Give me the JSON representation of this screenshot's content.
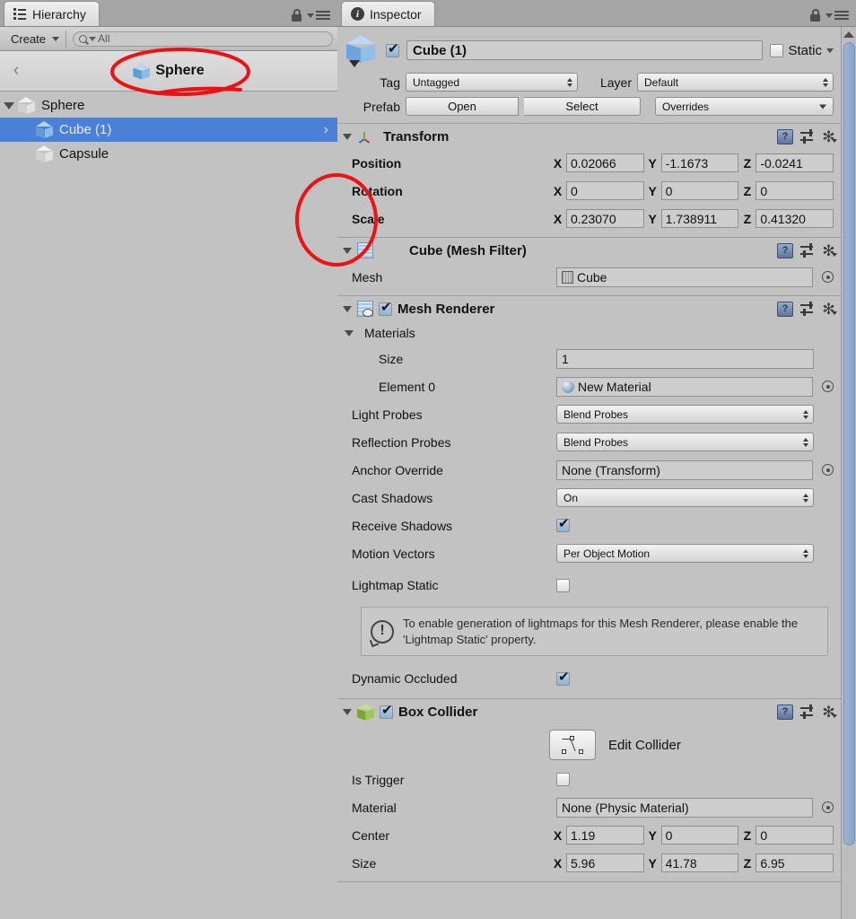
{
  "hierarchy": {
    "tab_label": "Hierarchy",
    "tab_icon": "hierarchy-list-icon",
    "create_label": "Create",
    "search_placeholder": "All",
    "breadcrumb_label": "Sphere",
    "breadcrumb_back": "‹",
    "tree": [
      {
        "label": "Sphere",
        "indent": 0,
        "icon": "white-cube-icon",
        "selected": false,
        "expanded": true
      },
      {
        "label": "Cube (1)",
        "indent": 1,
        "icon": "blue-cube-icon",
        "selected": true,
        "expanded": false,
        "chevron": "›"
      },
      {
        "label": "Capsule",
        "indent": 1,
        "icon": "white-cube-icon",
        "selected": false,
        "expanded": false
      }
    ]
  },
  "inspector": {
    "tab_label": "Inspector",
    "tab_icon": "info-icon",
    "object": {
      "enabled": true,
      "name": "Cube (1)",
      "static_label": "Static",
      "static_checked": false,
      "tag_label": "Tag",
      "tag_value": "Untagged",
      "layer_label": "Layer",
      "layer_value": "Default",
      "prefab_label": "Prefab",
      "prefab_open": "Open",
      "prefab_select": "Select",
      "prefab_overrides": "Overrides"
    },
    "transform": {
      "title": "Transform",
      "rows": [
        {
          "label": "Position",
          "x": "0.02066",
          "y": "-1.1673",
          "z": "-0.0241"
        },
        {
          "label": "Rotation",
          "x": "0",
          "y": "0",
          "z": "0"
        },
        {
          "label": "Scale",
          "x": "0.23070",
          "y": "1.738911",
          "z": "0.41320"
        }
      ],
      "axis_labels": {
        "x": "X",
        "y": "Y",
        "z": "Z"
      }
    },
    "mesh_filter": {
      "title": "Cube (Mesh Filter)",
      "mesh_label": "Mesh",
      "mesh_value": "Cube"
    },
    "mesh_renderer": {
      "title": "Mesh Renderer",
      "enabled": true,
      "materials_label": "Materials",
      "size_label": "Size",
      "size_value": "1",
      "element_label": "Element 0",
      "element_value": "New Material",
      "light_probes_label": "Light Probes",
      "light_probes_value": "Blend Probes",
      "reflection_probes_label": "Reflection Probes",
      "reflection_probes_value": "Blend Probes",
      "anchor_override_label": "Anchor Override",
      "anchor_override_value": "None (Transform)",
      "cast_shadows_label": "Cast Shadows",
      "cast_shadows_value": "On",
      "receive_shadows_label": "Receive Shadows",
      "receive_shadows_checked": true,
      "motion_vectors_label": "Motion Vectors",
      "motion_vectors_value": "Per Object Motion",
      "lightmap_static_label": "Lightmap Static",
      "lightmap_static_checked": false,
      "help_text": "To enable generation of lightmaps for this Mesh Renderer, please enable the 'Lightmap Static' property.",
      "dynamic_occluded_label": "Dynamic Occluded",
      "dynamic_occluded_checked": true
    },
    "box_collider": {
      "title": "Box Collider",
      "enabled": true,
      "edit_collider_label": "Edit Collider",
      "is_trigger_label": "Is Trigger",
      "is_trigger_checked": false,
      "material_label": "Material",
      "material_value": "None (Physic Material)",
      "center_label": "Center",
      "center": {
        "x": "1.19",
        "y": "0",
        "z": "0"
      },
      "size_label": "Size",
      "size": {
        "x": "5.96",
        "y": "41.78",
        "z": "6.95"
      }
    },
    "icons": {
      "help": "help-book-icon",
      "preset": "preset-icon",
      "settings": "gear-icon"
    }
  },
  "annotations": {
    "color": "#ee1111",
    "marks": [
      "ellipse-around-sphere-breadcrumb",
      "ellipse-near-transform-divider"
    ]
  },
  "colors": {
    "panel_bg": "#c2c2c2",
    "chrome_bg": "#a5a5a5",
    "selection_blue": "#4b80d8",
    "annotation_red": "#ee1111"
  }
}
